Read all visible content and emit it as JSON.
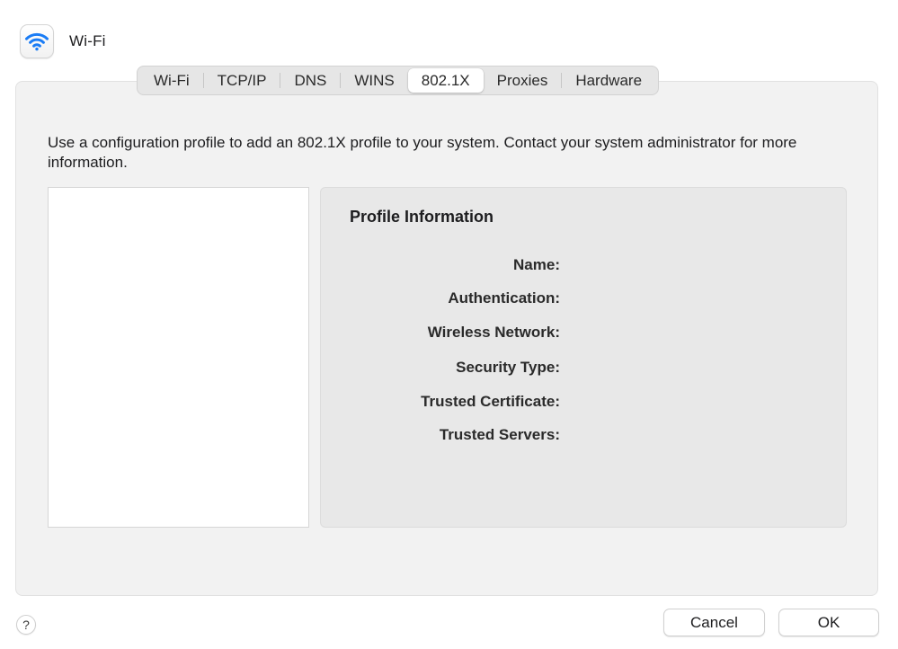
{
  "header": {
    "title": "Wi-Fi",
    "icon": "wifi-icon",
    "accent_color": "#1a7cf5"
  },
  "tabs": [
    {
      "label": "Wi-Fi",
      "selected": false
    },
    {
      "label": "TCP/IP",
      "selected": false
    },
    {
      "label": "DNS",
      "selected": false
    },
    {
      "label": "WINS",
      "selected": false
    },
    {
      "label": "802.1X",
      "selected": true
    },
    {
      "label": "Proxies",
      "selected": false
    },
    {
      "label": "Hardware",
      "selected": false
    }
  ],
  "main": {
    "description": "Use a configuration profile to add an 802.1X profile to your system. Contact your system administrator for more information.",
    "profile_list": [],
    "profile_info": {
      "title": "Profile Information",
      "fields": [
        {
          "label": "Name:",
          "value": ""
        },
        {
          "label": "Authentication:",
          "value": ""
        },
        {
          "label": "Wireless Network:",
          "value": ""
        },
        {
          "label": "Security Type:",
          "value": ""
        },
        {
          "label": "Trusted Certificate:",
          "value": ""
        },
        {
          "label": "Trusted Servers:",
          "value": ""
        }
      ]
    }
  },
  "footer": {
    "help_label": "?",
    "cancel_label": "Cancel",
    "ok_label": "OK"
  }
}
